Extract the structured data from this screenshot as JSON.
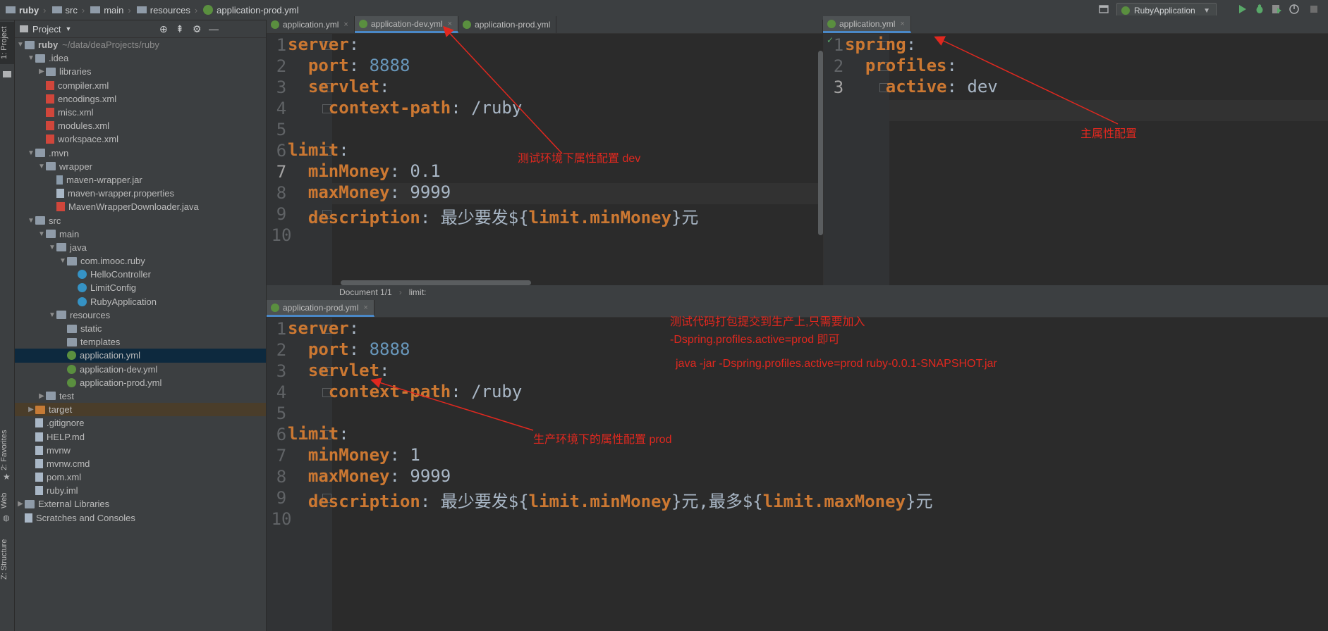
{
  "breadcrumb": [
    "ruby",
    "src",
    "main",
    "resources",
    "application-prod.yml"
  ],
  "run_config": "RubyApplication",
  "left_strip": {
    "project": "1: Project",
    "favorites": "2: Favorites",
    "web": "Web",
    "structure": "Z: Structure"
  },
  "project_panel": {
    "title": "Project",
    "tree": [
      {
        "label": "ruby",
        "extra": "~/data/deaProjects/ruby",
        "depth": 0,
        "arrow": "down",
        "icon": "folder"
      },
      {
        "label": ".idea",
        "depth": 1,
        "arrow": "down",
        "icon": "folder"
      },
      {
        "label": "libraries",
        "depth": 2,
        "arrow": "right",
        "icon": "folder"
      },
      {
        "label": "compiler.xml",
        "depth": 2,
        "icon": "xml"
      },
      {
        "label": "encodings.xml",
        "depth": 2,
        "icon": "xml"
      },
      {
        "label": "misc.xml",
        "depth": 2,
        "icon": "xml"
      },
      {
        "label": "modules.xml",
        "depth": 2,
        "icon": "xml"
      },
      {
        "label": "workspace.xml",
        "depth": 2,
        "icon": "xml"
      },
      {
        "label": ".mvn",
        "depth": 1,
        "arrow": "down",
        "icon": "folder"
      },
      {
        "label": "wrapper",
        "depth": 2,
        "arrow": "down",
        "icon": "folder"
      },
      {
        "label": "maven-wrapper.jar",
        "depth": 3,
        "icon": "jar"
      },
      {
        "label": "maven-wrapper.properties",
        "depth": 3,
        "icon": "file"
      },
      {
        "label": "MavenWrapperDownloader.java",
        "depth": 3,
        "icon": "xml"
      },
      {
        "label": "src",
        "depth": 1,
        "arrow": "down",
        "icon": "folder"
      },
      {
        "label": "main",
        "depth": 2,
        "arrow": "down",
        "icon": "folder"
      },
      {
        "label": "java",
        "depth": 3,
        "arrow": "down",
        "icon": "folder"
      },
      {
        "label": "com.imooc.ruby",
        "depth": 4,
        "arrow": "down",
        "icon": "folder"
      },
      {
        "label": "HelloController",
        "depth": 5,
        "icon": "class"
      },
      {
        "label": "LimitConfig",
        "depth": 5,
        "icon": "class"
      },
      {
        "label": "RubyApplication",
        "depth": 5,
        "icon": "class"
      },
      {
        "label": "resources",
        "depth": 3,
        "arrow": "down",
        "icon": "folder"
      },
      {
        "label": "static",
        "depth": 4,
        "icon": "folder"
      },
      {
        "label": "templates",
        "depth": 4,
        "icon": "folder"
      },
      {
        "label": "application.yml",
        "depth": 4,
        "icon": "yml",
        "selected": true
      },
      {
        "label": "application-dev.yml",
        "depth": 4,
        "icon": "yml"
      },
      {
        "label": "application-prod.yml",
        "depth": 4,
        "icon": "yml"
      },
      {
        "label": "test",
        "depth": 2,
        "arrow": "right",
        "icon": "folder"
      },
      {
        "label": "target",
        "depth": 1,
        "arrow": "right",
        "icon": "folder-orange",
        "highlight": true
      },
      {
        "label": ".gitignore",
        "depth": 1,
        "icon": "file"
      },
      {
        "label": "HELP.md",
        "depth": 1,
        "icon": "file"
      },
      {
        "label": "mvnw",
        "depth": 1,
        "icon": "file"
      },
      {
        "label": "mvnw.cmd",
        "depth": 1,
        "icon": "file"
      },
      {
        "label": "pom.xml",
        "depth": 1,
        "icon": "maven"
      },
      {
        "label": "ruby.iml",
        "depth": 1,
        "icon": "file"
      },
      {
        "label": "External Libraries",
        "depth": 0,
        "arrow": "right",
        "icon": "lib"
      },
      {
        "label": "Scratches and Consoles",
        "depth": 0,
        "icon": "scratch"
      }
    ]
  },
  "tabs_left": [
    {
      "label": "application.yml",
      "active": false,
      "close": "×"
    },
    {
      "label": "application-dev.yml",
      "active": true,
      "close": "×"
    },
    {
      "label": "application-prod.yml",
      "active": false
    }
  ],
  "tabs_right": [
    {
      "label": "application.yml",
      "active": true,
      "close": "×"
    }
  ],
  "tabs_bottom": [
    {
      "label": "application-prod.yml",
      "active": true,
      "close": "×"
    }
  ],
  "dev_editor": {
    "line_numbers": [
      "1",
      "2",
      "3",
      "4",
      "5",
      "6",
      "7",
      "8",
      "9",
      "10"
    ],
    "lines": [
      [
        {
          "t": "server",
          "c": "k"
        },
        {
          "t": ":",
          "c": "p"
        }
      ],
      [
        {
          "t": "  port",
          "c": "k"
        },
        {
          "t": ": ",
          "c": "p"
        },
        {
          "t": "8888",
          "c": "n"
        }
      ],
      [
        {
          "t": "  servlet",
          "c": "k"
        },
        {
          "t": ":",
          "c": "p"
        }
      ],
      [
        {
          "t": "    context-path",
          "c": "k"
        },
        {
          "t": ": /ruby",
          "c": "p"
        }
      ],
      [],
      [
        {
          "t": "limit",
          "c": "k"
        },
        {
          "t": ":",
          "c": "p"
        }
      ],
      [
        {
          "t": "  minMoney",
          "c": "k"
        },
        {
          "t": ": 0.1",
          "c": "p"
        }
      ],
      [
        {
          "t": "  maxMoney",
          "c": "k"
        },
        {
          "t": ": 9999",
          "c": "p"
        }
      ],
      [
        {
          "t": "  description",
          "c": "k"
        },
        {
          "t": ": 最少要发${",
          "c": "p"
        },
        {
          "t": "limit.minMoney",
          "c": "k"
        },
        {
          "t": "}元",
          "c": "p"
        }
      ],
      []
    ]
  },
  "main_editor": {
    "line_numbers": [
      "1",
      "2",
      "3"
    ],
    "lines": [
      [
        {
          "t": "spring",
          "c": "k"
        },
        {
          "t": ":",
          "c": "p"
        }
      ],
      [
        {
          "t": "  profiles",
          "c": "k"
        },
        {
          "t": ":",
          "c": "p"
        }
      ],
      [
        {
          "t": "    active",
          "c": "k"
        },
        {
          "t": ": dev",
          "c": "p"
        }
      ]
    ]
  },
  "prod_editor": {
    "line_numbers": [
      "1",
      "2",
      "3",
      "4",
      "5",
      "6",
      "7",
      "8",
      "9",
      "10"
    ],
    "lines": [
      [
        {
          "t": "server",
          "c": "k"
        },
        {
          "t": ":",
          "c": "p"
        }
      ],
      [
        {
          "t": "  port",
          "c": "k"
        },
        {
          "t": ": ",
          "c": "p"
        },
        {
          "t": "8888",
          "c": "n"
        }
      ],
      [
        {
          "t": "  servlet",
          "c": "k"
        },
        {
          "t": ":",
          "c": "p"
        }
      ],
      [
        {
          "t": "    context-path",
          "c": "k"
        },
        {
          "t": ": /ruby",
          "c": "p"
        }
      ],
      [],
      [
        {
          "t": "limit",
          "c": "k"
        },
        {
          "t": ":",
          "c": "p"
        }
      ],
      [
        {
          "t": "  minMoney",
          "c": "k"
        },
        {
          "t": ": 1",
          "c": "p"
        }
      ],
      [
        {
          "t": "  maxMoney",
          "c": "k"
        },
        {
          "t": ": 9999",
          "c": "p"
        }
      ],
      [
        {
          "t": "  description",
          "c": "k"
        },
        {
          "t": ": 最少要发${",
          "c": "p"
        },
        {
          "t": "limit.minMoney",
          "c": "k"
        },
        {
          "t": "}元,最多${",
          "c": "p"
        },
        {
          "t": "limit.maxMoney",
          "c": "k"
        },
        {
          "t": "}元",
          "c": "p"
        }
      ],
      []
    ]
  },
  "status": {
    "doc": "Document 1/1",
    "path": "limit:"
  },
  "annotations": {
    "dev": "测试环境下属性配置  dev",
    "main": "主属性配置",
    "prod": "生产环境下的属性配置  prod",
    "note1": "测试代码打包提交到生产上,只需要加入",
    "note2": "-Dspring.profiles.active=prod 即可",
    "note3": "java -jar -Dspring.profiles.active=prod ruby-0.0.1-SNAPSHOT.jar"
  }
}
